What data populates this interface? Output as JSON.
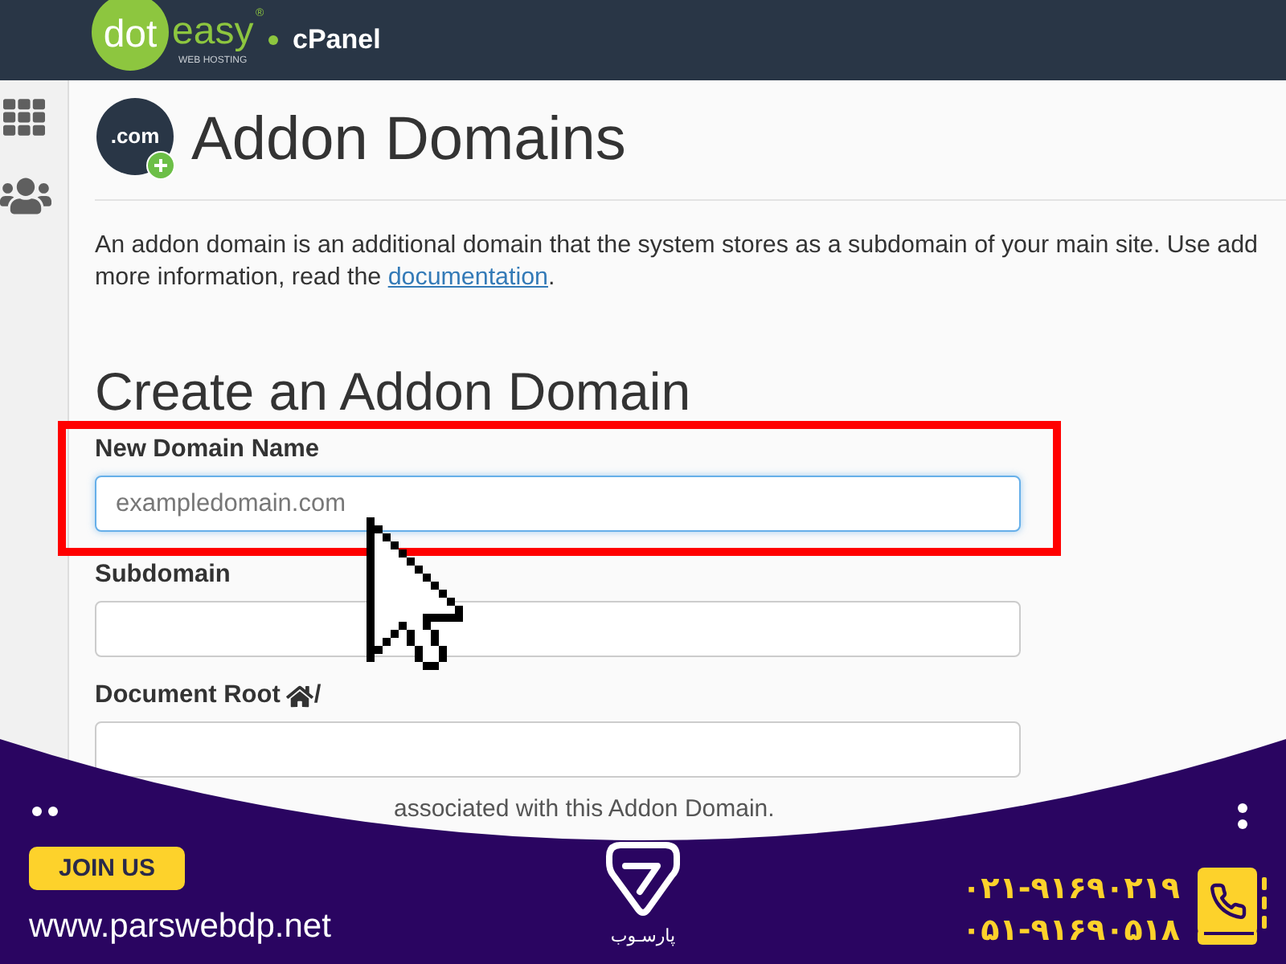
{
  "top_bar": {
    "logo": {
      "badge_text": "dot",
      "text": "easy",
      "mark": "®",
      "tagline": "WEB HOSTING"
    },
    "product": "cPanel"
  },
  "header": {
    "icon_text": ".com",
    "title": "Addon Domains"
  },
  "description": {
    "line_1": "An addon domain is an additional domain that the system stores as a subdomain of your main site. Use add",
    "line_2": "more information, read the ",
    "link": "documentation",
    "line_2_end": "."
  },
  "form": {
    "title": "Create an Addon Domain",
    "fields": [
      {
        "kind": "text",
        "label": "New Domain Name",
        "placeholder": "exampledomain.com",
        "focused": true,
        "highlighted": true
      },
      {
        "kind": "text",
        "label": "Subdomain",
        "focused": false,
        "highlighted": false
      },
      {
        "kind": "path",
        "label": "Document Root",
        "suffix": "/",
        "focused": false,
        "highlighted": false
      }
    ],
    "note": "associated with this Addon Domain."
  },
  "banner": {
    "button": "JOIN US",
    "website": "www.parswebdp.net",
    "logo_text": "پارسـوب",
    "phones": [
      "۰۲۱-۹۱۶۹۰۲۱۹",
      "۰۵۱-۹۱۶۹۰۵۱۸"
    ]
  }
}
